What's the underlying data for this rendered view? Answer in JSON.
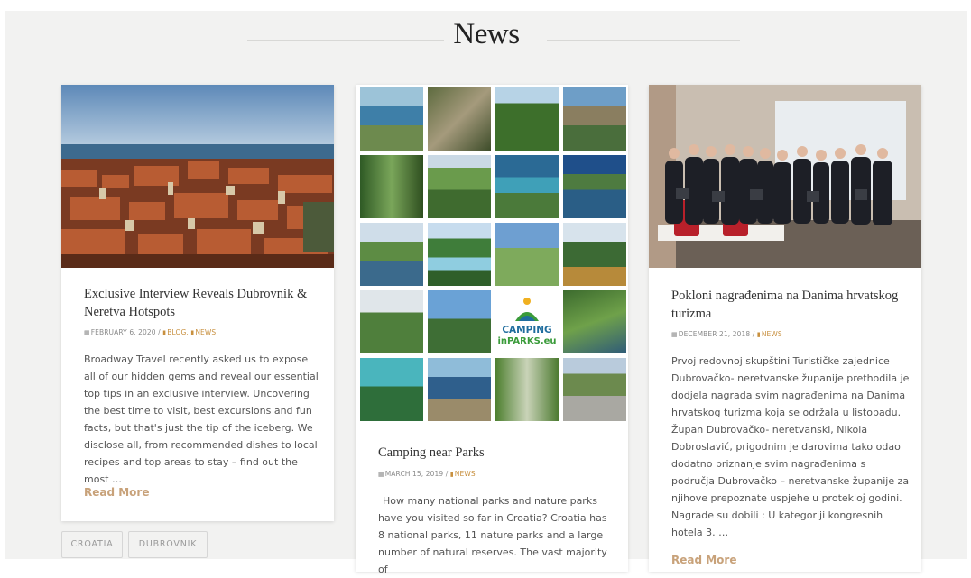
{
  "section": {
    "title": "News"
  },
  "cards": [
    {
      "title": "Exclusive Interview Reveals Dubrovnik & Neretva Hotspots",
      "date": "FEBRUARY 6, 2020",
      "cats": [
        "BLOG",
        "NEWS"
      ],
      "excerpt": "Broadway Travel recently asked us to expose all of our hidden gems and reveal our essential top tips in an exclusive interview. Uncovering the best time to visit, best excursions and fun facts, but that's just the tip of the iceberg. We disclose all, from recommended dishes to local recipes and top areas to stay – find out the most …",
      "read_more": "Read More",
      "tags": [
        "CROATIA",
        "DUBROVNIK"
      ]
    },
    {
      "title": "Camping near Parks",
      "date": "MARCH 15, 2019",
      "cats": [
        "NEWS"
      ],
      "excerpt": "How many national parks and nature parks have you visited so far in Croatia? Croatia has 8 national parks, 11 nature parks and a large number of natural reserves. The vast majority of",
      "logo_line1": "CAMPING",
      "logo_line2": "inPARKS.eu"
    },
    {
      "title": "Pokloni nagrađenima na Danima hrvatskog turizma",
      "date": "DECEMBER 21, 2018",
      "cats": [
        "NEWS"
      ],
      "excerpt": "Prvoj redovnoj skupštini Turističke zajednice Dubrovačko- neretvanske županije prethodila je dodjela nagrada svim nagrađenima na Danima hrvatskog turizma koja se održala u listopadu. Župan Dubrovačko- neretvanski, Nikola Dobroslavić, prigodnim je darovima tako odao dodatno priznanje svim nagrađenima s područja Dubrovačko – neretvanske županije za njihove prepoznate uspjehe u proteklој godini. Nagrade su dobili : U kategoriji kongresnih hotela 3. …",
      "read_more": "Read More"
    }
  ],
  "colors": {
    "accent": "#c8903f",
    "read_more": "#c8a27a",
    "background": "#f2f2f1"
  }
}
